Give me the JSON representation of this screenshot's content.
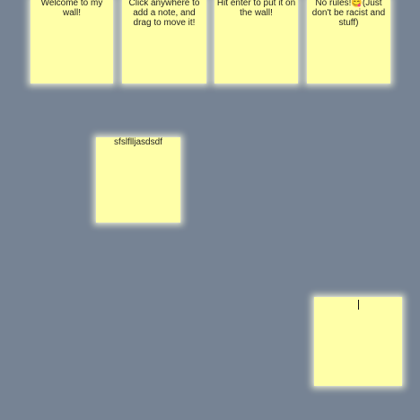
{
  "notes": [
    {
      "text": "Welcome to my wall!"
    },
    {
      "text": "Click anywhere to add a note, and drag to move it!"
    },
    {
      "text": "Hit enter to put it on the wall!"
    },
    {
      "text": "No rules!😋(Just don't be racist and stuff)"
    },
    {
      "text": "sfslflljasdsdf"
    },
    {
      "text": "",
      "placeholder": ""
    }
  ],
  "colors": {
    "wall_background": "#768394",
    "note_background": "#ffffa8",
    "note_glow": "#ffffe1"
  }
}
